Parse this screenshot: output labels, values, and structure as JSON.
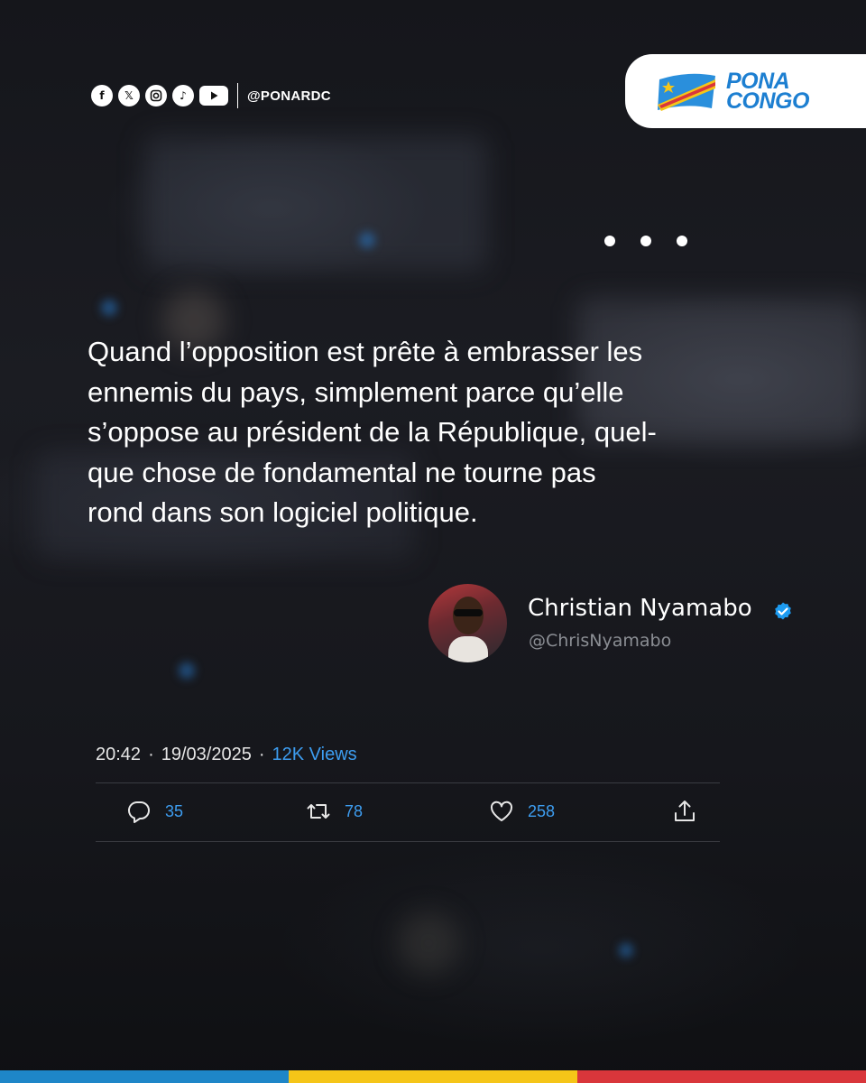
{
  "header": {
    "handle": "@PONARDC",
    "social_icons": [
      "facebook-icon",
      "x-icon",
      "instagram-icon",
      "tiktok-icon",
      "youtube-icon"
    ]
  },
  "brand": {
    "logo_line1": "PONA",
    "logo_line2": "CONGO",
    "accent": "#1d7fd1"
  },
  "tweet": {
    "text": "Quand l’opposition est prête à embrasser les ennemis du pays, simplement parce qu’elle s’oppose au président de la République, quel-que chose de fondamental ne tourne pas rond dans son logiciel politique.",
    "lines": [
      "Quand l’opposition est prête à embrasser les",
      "ennemis du pays, simplement parce qu’elle",
      "s’oppose au président de la République, quel-",
      "que chose de fondamental ne tourne pas",
      "rond dans son logiciel politique."
    ],
    "author_name": "Christian Nyamabo",
    "author_handle": "@ChrisNyamabo",
    "time": "20:42",
    "date": "19/03/2025",
    "separator": "·",
    "views": "12K Views",
    "replies": "35",
    "retweets": "78",
    "likes": "258"
  },
  "colors": {
    "stripe": [
      "#1e86c8",
      "#f5c518",
      "#d9363b"
    ],
    "link_blue": "#3d9df0"
  }
}
